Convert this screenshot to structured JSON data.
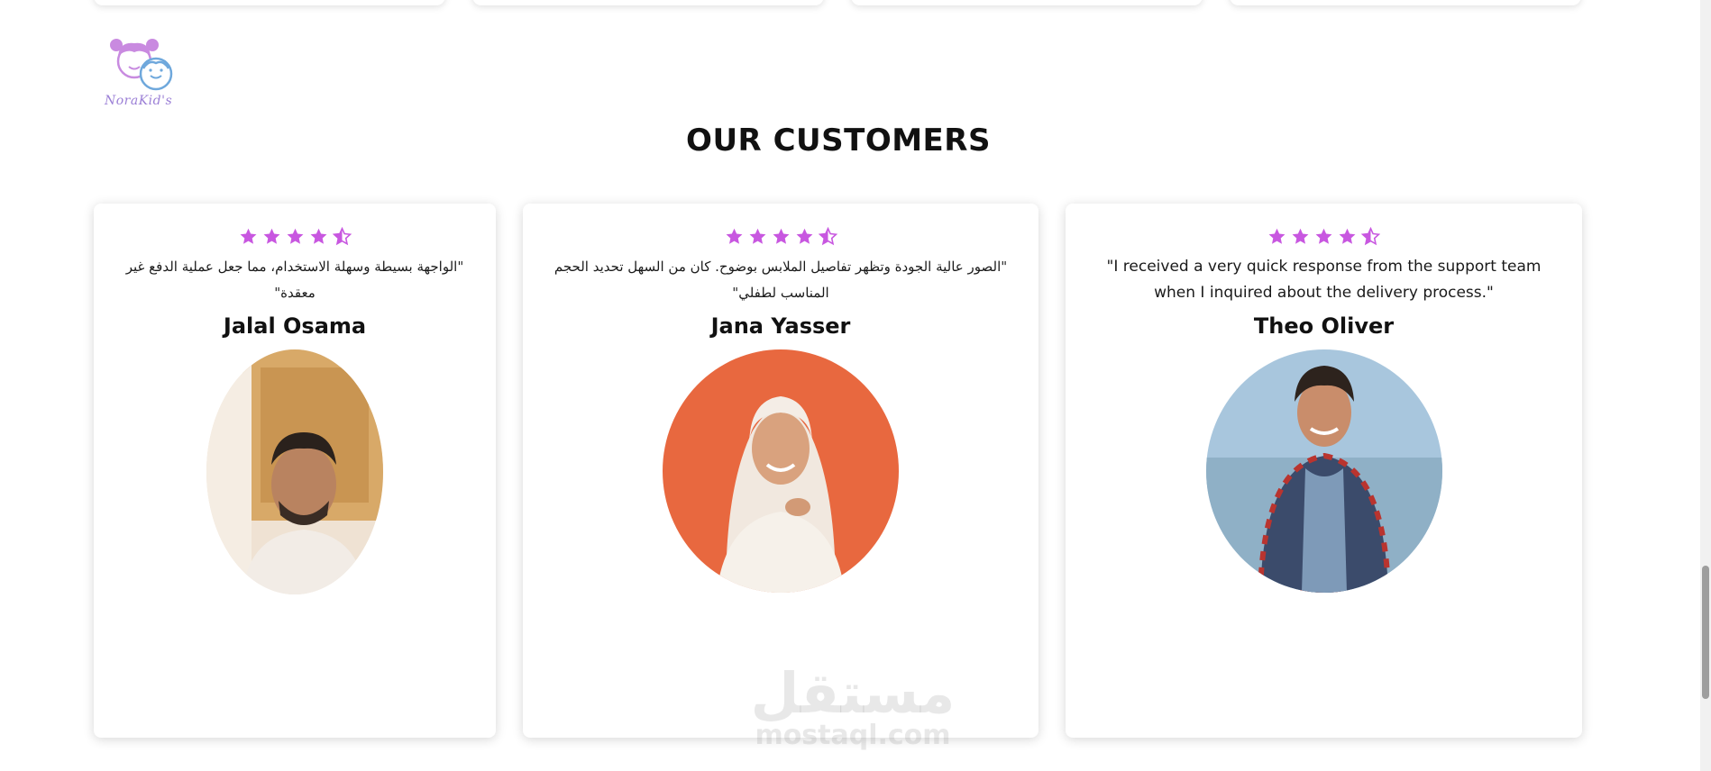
{
  "brand": {
    "logo_text": "NoraKid's",
    "colors": {
      "primary": "#c873e0",
      "secondary": "#6fa8dc"
    }
  },
  "section": {
    "title": "OUR CUSTOMERS"
  },
  "rating": {
    "value": 4.5,
    "max": 5,
    "star_color": "#c857e0"
  },
  "testimonials": [
    {
      "quote": "\"الواجهة بسيطة وسهلة الاستخدام، مما جعل عملية الدفع غير معقدة\"",
      "name": "Jalal Osama",
      "rating": 4.5,
      "photo_icon": "customer-photo-jalal"
    },
    {
      "quote": "\"الصور عالية الجودة وتظهر تفاصيل الملابس بوضوح. كان من السهل تحديد الحجم المناسب لطفلي\"",
      "name": "Jana Yasser",
      "rating": 4.5,
      "photo_icon": "customer-photo-jana"
    },
    {
      "quote": "\"I received a very quick response from the support team when I inquired about the delivery process.\"",
      "name": "Theo Oliver",
      "rating": 4.5,
      "photo_icon": "customer-photo-theo"
    }
  ],
  "watermark": {
    "arabic": "مستقل",
    "latin": "mostaql.com"
  }
}
